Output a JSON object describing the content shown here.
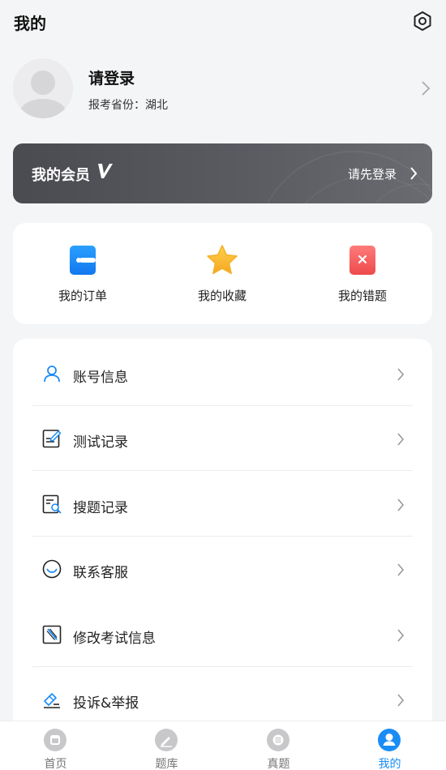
{
  "header": {
    "title": "我的",
    "settings_icon": "settings-hexagon-icon"
  },
  "profile": {
    "login_label": "请登录",
    "province_text": "报考省份：湖北",
    "avatar_icon": "default-avatar-icon"
  },
  "vip": {
    "title": "我的会员",
    "badge_icon": "vip-v-icon",
    "login_prompt": "请先登录"
  },
  "shortcuts": [
    {
      "label": "我的订单",
      "icon": "order-icon",
      "color": "#1a8cf5"
    },
    {
      "label": "我的收藏",
      "icon": "star-icon",
      "color": "#f7b928"
    },
    {
      "label": "我的错题",
      "icon": "wrong-answer-icon",
      "color": "#ef5350"
    }
  ],
  "menu": [
    {
      "label": "账号信息",
      "icon": "user-icon"
    },
    {
      "label": "测试记录",
      "icon": "edit-record-icon"
    },
    {
      "label": "搜题记录",
      "icon": "search-record-icon"
    },
    {
      "label": "联系客服",
      "icon": "customer-service-icon"
    },
    {
      "label": "修改考试信息",
      "icon": "modify-exam-icon"
    },
    {
      "label": "投诉&举报",
      "icon": "complaint-icon"
    }
  ],
  "tabbar": [
    {
      "label": "首页",
      "icon": "home-icon",
      "active": false
    },
    {
      "label": "题库",
      "icon": "question-bank-icon",
      "active": false
    },
    {
      "label": "真题",
      "icon": "past-papers-icon",
      "active": false
    },
    {
      "label": "我的",
      "icon": "profile-icon",
      "active": true
    }
  ],
  "colors": {
    "accent": "#1a8cf5",
    "vip_bg": "#55565b",
    "page_bg": "#f4f5f7"
  }
}
